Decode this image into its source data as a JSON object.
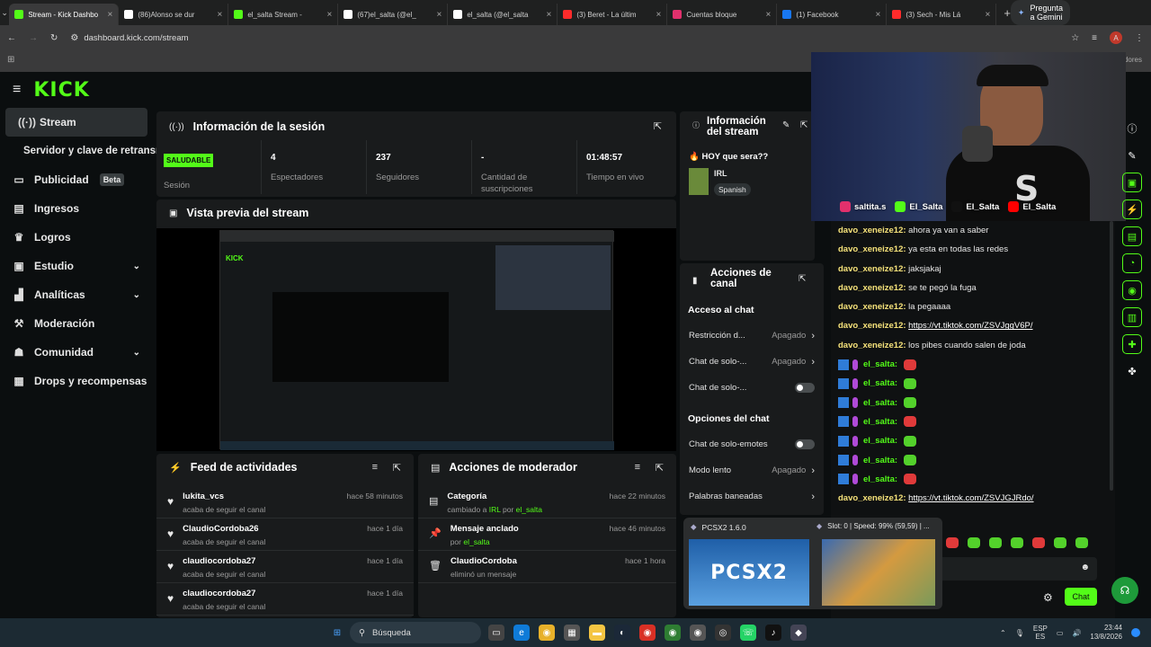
{
  "browser": {
    "tabs": [
      {
        "title": "Stream - Kick Dashbo",
        "color": "#53fc18",
        "active": true
      },
      {
        "title": "(86)Alonso se dur",
        "color": "#ffffff"
      },
      {
        "title": "el_salta Stream -",
        "color": "#53fc18"
      },
      {
        "title": "(67)el_salta (@el_",
        "color": "#ffffff"
      },
      {
        "title": "el_salta (@el_salta",
        "color": "#ffffff"
      },
      {
        "title": "(3) Beret - La últim",
        "color": "#ff2b2b"
      },
      {
        "title": "Cuentas bloque",
        "color": "#e1306c"
      },
      {
        "title": "(1) Facebook",
        "color": "#1877f2"
      },
      {
        "title": "(3) Sech - Mis Lá",
        "color": "#ff2b2b"
      }
    ],
    "gemini_label": "Pregunta a Gemini",
    "url": "dashboard.kick.com/stream",
    "bookmark_right": "dores"
  },
  "sidebar": {
    "items": [
      {
        "label": "Stream",
        "icon": "broadcast-icon",
        "glyph": "((·))"
      },
      {
        "label": "Servidor y clave de retransmisión",
        "icon": "",
        "glyph": ""
      },
      {
        "label": "Publicidad",
        "icon": "ad-icon",
        "glyph": "▭",
        "badge": "Beta"
      },
      {
        "label": "Ingresos",
        "icon": "income-icon",
        "glyph": "▤"
      },
      {
        "label": "Logros",
        "icon": "trophy-icon",
        "glyph": "♛"
      },
      {
        "label": "Estudio",
        "icon": "studio-icon",
        "glyph": "▣",
        "chevron": true
      },
      {
        "label": "Analíticas",
        "icon": "chart-icon",
        "glyph": "▟",
        "chevron": true
      },
      {
        "label": "Moderación",
        "icon": "hammer-icon",
        "glyph": "⚒"
      },
      {
        "label": "Comunidad",
        "icon": "community-icon",
        "glyph": "☗",
        "chevron": true
      },
      {
        "label": "Drops y recompensas",
        "icon": "gift-icon",
        "glyph": "▦"
      }
    ]
  },
  "session": {
    "title": "Información de la sesión",
    "status": "SALUDABLE",
    "status_label": "Sesión",
    "stats": [
      {
        "value": "4",
        "label": "Espectadores"
      },
      {
        "value": "237",
        "label": "Seguidores"
      },
      {
        "value": "-",
        "label": "Cantidad de suscripciones"
      },
      {
        "value": "01:48:57",
        "label": "Tiempo en vivo"
      }
    ]
  },
  "stream_info": {
    "title": "Información del stream",
    "stream_title": "HOY que sera??",
    "category": "IRL",
    "language": "Spanish"
  },
  "preview": {
    "title": "Vista previa del stream"
  },
  "activity": {
    "title": "Feed de actividades",
    "items": [
      {
        "name": "lukita_vcs",
        "sub": "acaba de seguir el canal",
        "time": "hace 58 minutos"
      },
      {
        "name": "ClaudioCordoba26",
        "sub": "acaba de seguir el canal",
        "time": "hace 1 día"
      },
      {
        "name": "claudiocordoba27",
        "sub": "acaba de seguir el canal",
        "time": "hace 1 día"
      },
      {
        "name": "claudiocordoba27",
        "sub": "acaba de seguir el canal",
        "time": "hace 1 día"
      }
    ]
  },
  "moderator": {
    "title": "Acciones de moderador",
    "items": [
      {
        "name": "Categoría",
        "pre": "cambiado a ",
        "hl1": "IRL",
        "mid": " por ",
        "hl2": "el_salta",
        "time": "hace 22 minutos",
        "icon": "category-icon",
        "glyph": "▤"
      },
      {
        "name": "Mensaje anclado",
        "pre": "por ",
        "hl1": "el_salta",
        "mid": "",
        "hl2": "",
        "time": "hace 46 minutos",
        "icon": "pin-icon",
        "glyph": "📌"
      },
      {
        "name": "ClaudioCordoba",
        "pre": "eliminó un mensaje",
        "hl1": "",
        "mid": "",
        "hl2": "",
        "time": "hace 1 hora",
        "icon": "trash-icon",
        "glyph": "🗑"
      }
    ]
  },
  "channel_actions": {
    "title": "Acciones de canal",
    "chat_access": "Acceso al chat",
    "rows1": [
      {
        "label": "Restricción d...",
        "value": "Apagado",
        "type": "chevron"
      },
      {
        "label": "Chat de solo-...",
        "value": "Apagado",
        "type": "chevron"
      },
      {
        "label": "Chat de solo-...",
        "value": "",
        "type": "toggle"
      }
    ],
    "chat_options": "Opciones del chat",
    "rows2": [
      {
        "label": "Chat de solo-emotes",
        "value": "",
        "type": "toggle"
      },
      {
        "label": "Modo lento",
        "value": "Apagado",
        "type": "chevron"
      },
      {
        "label": "Palabras baneadas",
        "value": "",
        "type": "chevron"
      }
    ]
  },
  "webcam": {
    "overlay": [
      {
        "icon": "instagram-icon",
        "label": "saltita.s"
      },
      {
        "icon": "kick-icon",
        "label": "El_Salta"
      },
      {
        "icon": "tiktok-icon",
        "label": "El_Salta"
      },
      {
        "icon": "youtube-icon",
        "label": "El_Salta"
      }
    ]
  },
  "chat": {
    "messages": [
      {
        "user": "davo_xeneize12",
        "text": "ahora ya van a saber",
        "link": false
      },
      {
        "user": "davo_xeneize12",
        "text": "ya esta en todas las redes",
        "link": false
      },
      {
        "user": "davo_xeneize12",
        "text": "jaksjakaj",
        "link": false
      },
      {
        "user": "davo_xeneize12",
        "text": "se te pegó la fuga",
        "link": false
      },
      {
        "user": "davo_xeneize12",
        "text": "la pegaaaa",
        "link": false
      },
      {
        "user": "davo_xeneize12",
        "text": "https://vt.tiktok.com/ZSVJggV6P/",
        "link": true
      },
      {
        "user": "davo_xeneize12",
        "text": "los pibes cuando salen de joda",
        "link": false
      },
      {
        "user": "el_salta",
        "emote": "#e03a3a",
        "mod": true
      },
      {
        "user": "el_salta",
        "emote": "#53d12b",
        "mod": true
      },
      {
        "user": "el_salta",
        "emote": "#53d12b",
        "mod": true
      },
      {
        "user": "el_salta",
        "emote": "#e03a3a",
        "mod": true
      },
      {
        "user": "el_salta",
        "emote": "#53d12b",
        "mod": true
      },
      {
        "user": "el_salta",
        "emote": "#53d12b",
        "mod": true
      },
      {
        "user": "el_salta",
        "emote": "#e03a3a",
        "mod": true
      },
      {
        "user": "davo_xeneize12",
        "text": "https://vt.tiktok.com/ZSVJGJRdo/",
        "link": true
      }
    ],
    "send_label": "Chat"
  },
  "popups": {
    "pcsx2_title": "PCSX2  1.6.0",
    "pcsx2_logo": "PCSX2",
    "slot_title": "Slot: 0 | Speed: 99% (59,59) | ..."
  },
  "taskbar": {
    "search": "Búsqueda",
    "lang": "ESP",
    "lang2": "ES",
    "time": "23:44",
    "date": "13/8/2026"
  },
  "colors": {
    "kick_green": "#53fc18",
    "panel": "#191b1c",
    "bg": "#0b0e0f"
  }
}
